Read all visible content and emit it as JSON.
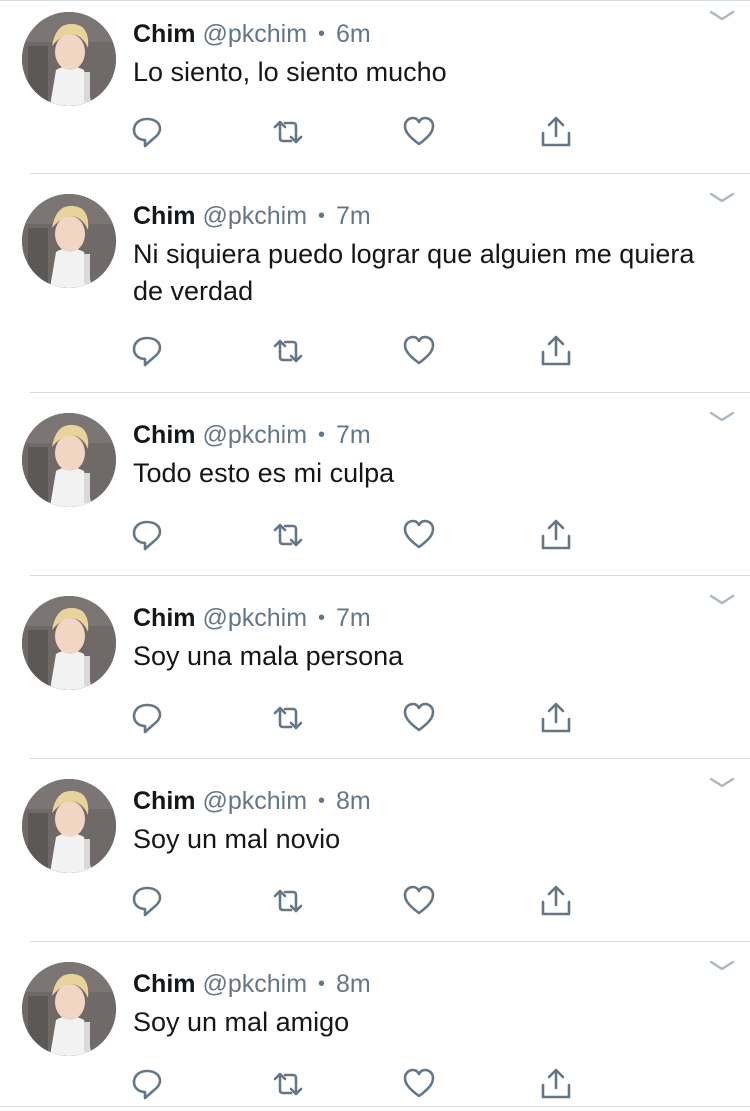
{
  "colors": {
    "text": "#14171a",
    "secondary": "#657786",
    "icon": "#657786",
    "divider": "#d8dde1"
  },
  "icons": {
    "reply": "reply-icon",
    "retweet": "retweet-icon",
    "like": "heart-icon",
    "share": "share-icon",
    "menu": "chevron-down-icon"
  },
  "tweets": [
    {
      "name": "Chim",
      "handle": "@pkchim",
      "time": "6m",
      "text": "Lo siento, lo siento mucho"
    },
    {
      "name": "Chim",
      "handle": "@pkchim",
      "time": "7m",
      "text": "Ni siquiera puedo lograr que alguien me quiera de verdad"
    },
    {
      "name": "Chim",
      "handle": "@pkchim",
      "time": "7m",
      "text": "Todo esto es mi culpa"
    },
    {
      "name": "Chim",
      "handle": "@pkchim",
      "time": "7m",
      "text": "Soy una mala persona"
    },
    {
      "name": "Chim",
      "handle": "@pkchim",
      "time": "8m",
      "text": "Soy un mal novio"
    },
    {
      "name": "Chim",
      "handle": "@pkchim",
      "time": "8m",
      "text": "Soy un mal amigo"
    }
  ]
}
